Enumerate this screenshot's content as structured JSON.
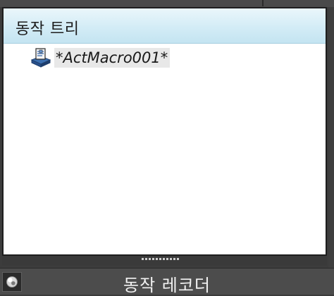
{
  "panel": {
    "title": "동작 트리",
    "tree_items": [
      {
        "label": "*ActMacro001*",
        "icon": "macro-recorder-icon"
      }
    ]
  },
  "bottom_bar": {
    "title": "동작 레코더",
    "record_icon": "record-button-icon"
  },
  "colors": {
    "header_top": "#eaf6fb",
    "header_bottom": "#c4e4f1",
    "frame": "#3c3c3c",
    "item_highlight": "#e8e8e8"
  }
}
